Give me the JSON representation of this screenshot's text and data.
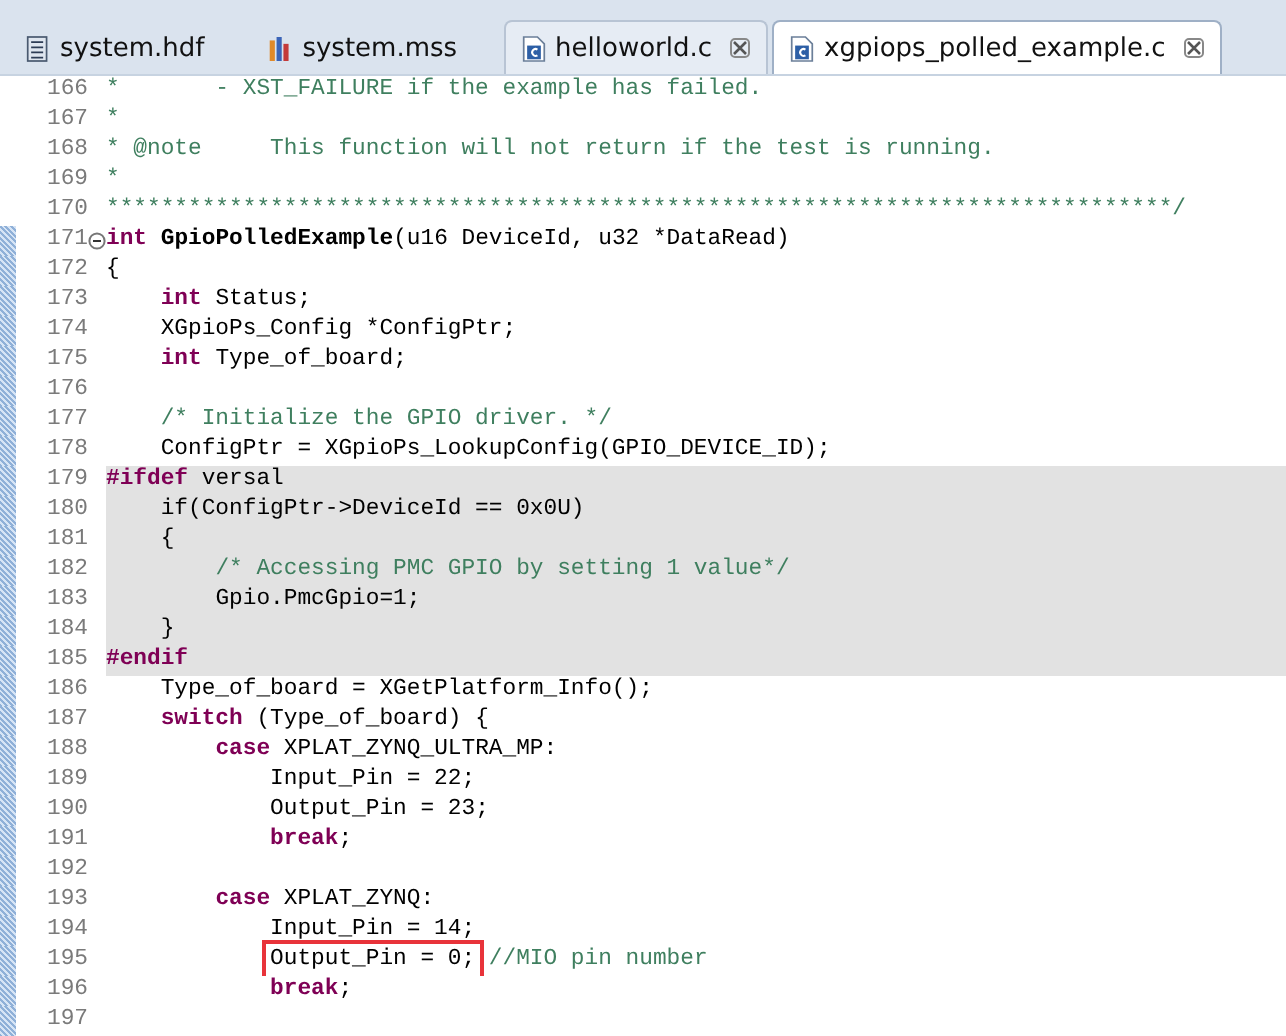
{
  "tabs": [
    {
      "label": "system.hdf",
      "kind": "hardware",
      "closable": false,
      "selected": false
    },
    {
      "label": "system.mss",
      "kind": "software",
      "closable": false,
      "selected": false
    },
    {
      "label": "helloworld.c",
      "kind": "source",
      "closable": true,
      "selected": false
    },
    {
      "label": "xgpiops_polled_example.c",
      "kind": "source",
      "closable": true,
      "selected": true
    }
  ],
  "lines": [
    {
      "number": "166",
      "inactive": false,
      "ruler": false,
      "foldable": false,
      "segments": [
        {
          "kind": "comment",
          "text": "*       - XST_FAILURE if the example has failed."
        }
      ]
    },
    {
      "number": "167",
      "inactive": false,
      "ruler": false,
      "foldable": false,
      "segments": [
        {
          "kind": "comment",
          "text": "*"
        }
      ]
    },
    {
      "number": "168",
      "inactive": false,
      "ruler": false,
      "foldable": false,
      "segments": [
        {
          "kind": "comment",
          "text": "* @note     This function will not return if the test is running."
        }
      ]
    },
    {
      "number": "169",
      "inactive": false,
      "ruler": false,
      "foldable": false,
      "segments": [
        {
          "kind": "comment",
          "text": "*"
        }
      ]
    },
    {
      "number": "170",
      "inactive": false,
      "ruler": false,
      "foldable": false,
      "segments": [
        {
          "kind": "comment",
          "text": "******************************************************************************/"
        }
      ]
    },
    {
      "number": "171",
      "inactive": false,
      "ruler": true,
      "foldable": true,
      "segments": [
        {
          "kind": "keyword",
          "text": "int"
        },
        {
          "kind": "function",
          "text": " GpioPolledExample"
        },
        {
          "kind": "plain",
          "text": "(u16 DeviceId, u32 *DataRead)"
        }
      ]
    },
    {
      "number": "172",
      "inactive": false,
      "ruler": true,
      "foldable": false,
      "segments": [
        {
          "kind": "plain",
          "text": "{"
        }
      ]
    },
    {
      "number": "173",
      "inactive": false,
      "ruler": true,
      "foldable": false,
      "segments": [
        {
          "kind": "keyword",
          "text": "    int"
        },
        {
          "kind": "plain",
          "text": " Status;"
        }
      ]
    },
    {
      "number": "174",
      "inactive": false,
      "ruler": true,
      "foldable": false,
      "segments": [
        {
          "kind": "plain",
          "text": "    XGpioPs_Config *ConfigPtr;"
        }
      ]
    },
    {
      "number": "175",
      "inactive": false,
      "ruler": true,
      "foldable": false,
      "segments": [
        {
          "kind": "keyword",
          "text": "    int"
        },
        {
          "kind": "plain",
          "text": " Type_of_board;"
        }
      ]
    },
    {
      "number": "176",
      "inactive": false,
      "ruler": true,
      "foldable": false
    },
    {
      "number": "177",
      "inactive": false,
      "ruler": true,
      "foldable": false,
      "segments": [
        {
          "kind": "comment",
          "text": "    /* Initialize the GPIO driver. */"
        }
      ]
    },
    {
      "number": "178",
      "inactive": false,
      "ruler": true,
      "foldable": false,
      "segments": [
        {
          "kind": "plain",
          "text": "    ConfigPtr = XGpioPs_LookupConfig(GPIO_DEVICE_ID);"
        }
      ]
    },
    {
      "number": "179",
      "inactive": true,
      "ruler": true,
      "foldable": false,
      "segments": [
        {
          "kind": "keyword",
          "text": "#ifdef"
        },
        {
          "kind": "plain",
          "text": " versal"
        }
      ]
    },
    {
      "number": "180",
      "inactive": true,
      "ruler": true,
      "foldable": false,
      "segments": [
        {
          "kind": "plain",
          "text": "    if(ConfigPtr->DeviceId == 0x0U)"
        }
      ]
    },
    {
      "number": "181",
      "inactive": true,
      "ruler": true,
      "foldable": false,
      "segments": [
        {
          "kind": "plain",
          "text": "    {"
        }
      ]
    },
    {
      "number": "182",
      "inactive": true,
      "ruler": true,
      "foldable": false,
      "segments": [
        {
          "kind": "comment",
          "text": "        /* Accessing PMC GPIO by setting 1 value*/"
        }
      ]
    },
    {
      "number": "183",
      "inactive": true,
      "ruler": true,
      "foldable": false,
      "segments": [
        {
          "kind": "plain",
          "text": "        Gpio.PmcGpio=1;"
        }
      ]
    },
    {
      "number": "184",
      "inactive": true,
      "ruler": true,
      "foldable": false,
      "segments": [
        {
          "kind": "plain",
          "text": "    }"
        }
      ]
    },
    {
      "number": "185",
      "inactive": true,
      "ruler": true,
      "foldable": false,
      "segments": [
        {
          "kind": "keyword",
          "text": "#endif"
        }
      ]
    },
    {
      "number": "186",
      "inactive": false,
      "ruler": true,
      "foldable": false,
      "segments": [
        {
          "kind": "plain",
          "text": "    Type_of_board = XGetPlatform_Info();"
        }
      ]
    },
    {
      "number": "187",
      "inactive": false,
      "ruler": true,
      "foldable": false,
      "segments": [
        {
          "kind": "keyword",
          "text": "    switch"
        },
        {
          "kind": "plain",
          "text": " (Type_of_board) {"
        }
      ]
    },
    {
      "number": "188",
      "inactive": false,
      "ruler": true,
      "foldable": false,
      "segments": [
        {
          "kind": "keyword",
          "text": "        case"
        },
        {
          "kind": "plain",
          "text": " XPLAT_ZYNQ_ULTRA_MP:"
        }
      ]
    },
    {
      "number": "189",
      "inactive": false,
      "ruler": true,
      "foldable": false,
      "segments": [
        {
          "kind": "plain",
          "text": "            Input_Pin = 22;"
        }
      ]
    },
    {
      "number": "190",
      "inactive": false,
      "ruler": true,
      "foldable": false,
      "segments": [
        {
          "kind": "plain",
          "text": "            Output_Pin = 23;"
        }
      ]
    },
    {
      "number": "191",
      "inactive": false,
      "ruler": true,
      "foldable": false,
      "segments": [
        {
          "kind": "keyword",
          "text": "            break"
        },
        {
          "kind": "plain",
          "text": ";"
        }
      ]
    },
    {
      "number": "192",
      "inactive": false,
      "ruler": true,
      "foldable": false
    },
    {
      "number": "193",
      "inactive": false,
      "ruler": true,
      "foldable": false,
      "segments": [
        {
          "kind": "keyword",
          "text": "        case"
        },
        {
          "kind": "plain",
          "text": " XPLAT_ZYNQ:"
        }
      ]
    },
    {
      "number": "194",
      "inactive": false,
      "ruler": true,
      "foldable": false,
      "segments": [
        {
          "kind": "plain",
          "text": "            Input_Pin = 14;"
        }
      ]
    },
    {
      "number": "195",
      "inactive": false,
      "ruler": true,
      "foldable": false,
      "segments": [
        {
          "kind": "boxed",
          "text": "            Output_Pin = 0;"
        },
        {
          "kind": "comment",
          "text": " //MIO pin number"
        }
      ]
    },
    {
      "number": "196",
      "inactive": false,
      "ruler": true,
      "foldable": false,
      "segments": [
        {
          "kind": "keyword",
          "text": "            break"
        },
        {
          "kind": "plain",
          "text": ";"
        }
      ]
    },
    {
      "number": "197",
      "inactive": false,
      "ruler": true,
      "foldable": false
    }
  ]
}
